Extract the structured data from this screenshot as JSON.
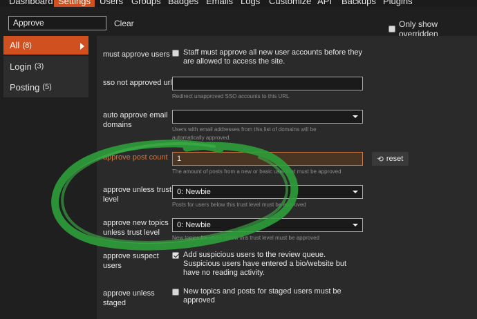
{
  "nav": {
    "tabs": [
      "Dashboard",
      "Settings",
      "Users",
      "Groups",
      "Badges",
      "Emails",
      "Logs",
      "Customize",
      "API",
      "Backups",
      "Plugins"
    ],
    "active": "Settings"
  },
  "filter": {
    "value": "Approve",
    "clear_label": "Clear",
    "only_overridden_label": "Only show overridden"
  },
  "sidebar": {
    "items": [
      {
        "label": "All",
        "count": "(8)"
      },
      {
        "label": "Login",
        "count": "(3)"
      },
      {
        "label": "Posting",
        "count": "(5)"
      }
    ]
  },
  "settings": {
    "must_approve_users": {
      "label": "must approve users",
      "text": "Staff must approve all new user accounts before they are allowed to access the site."
    },
    "sso_not_approved_url": {
      "label": "sso not approved url",
      "description": "Redirect unapproved SSO accounts to this URL"
    },
    "auto_approve_email_domains": {
      "label": "auto approve email domains",
      "description": "Users with email addresses from this list of domains will be automatically approved."
    },
    "approve_post_count": {
      "label": "approve post count",
      "value": "1",
      "description": "The amount of posts from a new or basic user that must be approved",
      "reset_label": "reset"
    },
    "approve_unless_trust_level": {
      "label": "approve unless trust level",
      "value": "0: Newbie",
      "description": "Posts for users below this trust level must be approved"
    },
    "approve_new_topics_unless_trust_level": {
      "label": "approve new topics unless trust level",
      "value": "0: Newbie",
      "description": "New topics for users below this trust level must be approved"
    },
    "approve_suspect_users": {
      "label": "approve suspect users",
      "text": "Add suspicious users to the review queue. Suspicious users have entered a bio/website but have no reading activity."
    },
    "approve_unless_staged": {
      "label": "approve unless staged",
      "text": "New topics and posts for staged users must be approved"
    }
  },
  "colors": {
    "accent": "#d0501f",
    "modified_label": "#c9794a",
    "annotation_green": "#2e9e3a"
  },
  "icons": {
    "reset": "undo-icon",
    "sidebar_active": "caret-right-icon",
    "select": "caret-down-icon"
  }
}
